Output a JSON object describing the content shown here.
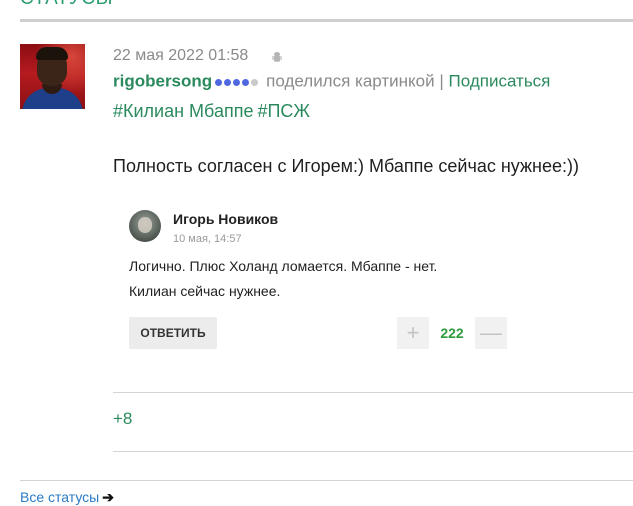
{
  "section": {
    "title": "СТАТУСЫ"
  },
  "post": {
    "date": "22 мая 2022 01:58",
    "device_icon": "android-icon",
    "username": "rigobersong",
    "rating_dots": {
      "filled": 4,
      "total": 5
    },
    "action": "поделился картинкой",
    "separator": "|",
    "subscribe_label": "Подписаться",
    "tags": [
      "#Килиан Мбаппе",
      "#ПСЖ"
    ],
    "text": "Полность согласен с Игорем:) Мбаппе сейчас нужнее:))",
    "rating": "+8"
  },
  "embedded_comment": {
    "author": "Игорь Новиков",
    "date": "10 мая, 14:57",
    "lines": [
      "Логично. Плюс Холанд ломается. Мбаппе - нет.",
      "Килиан сейчас нужнее."
    ],
    "reply_label": "ОТВЕТИТЬ",
    "plus_symbol": "+",
    "minus_symbol": "—",
    "votes": "222"
  },
  "footer": {
    "all_statuses_label": "Все статусы",
    "arrow": "➔"
  },
  "colors": {
    "accent_green": "#2b8a5d",
    "link_blue": "#2a7bc4",
    "vote_green": "#2f9a3c",
    "dot_blue": "#4f68e0"
  }
}
